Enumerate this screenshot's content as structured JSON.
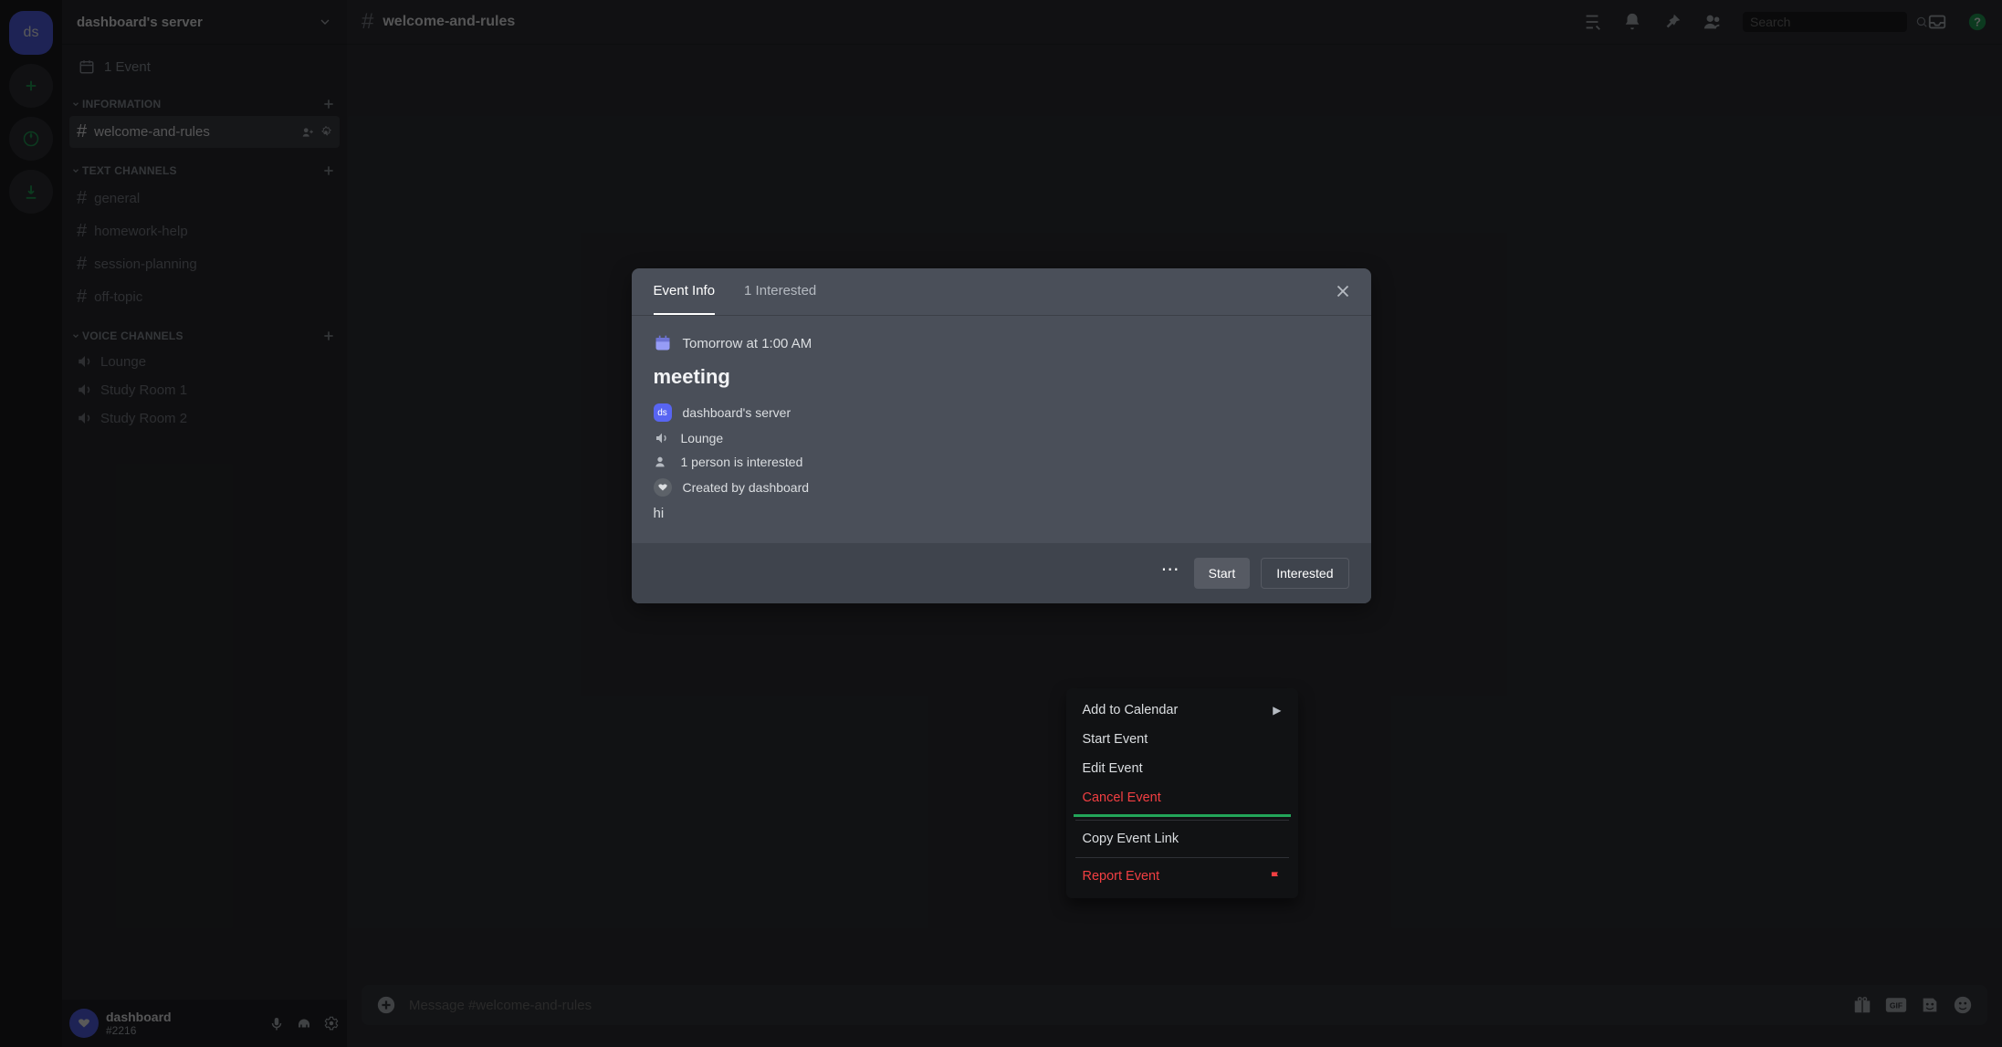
{
  "server": {
    "initials": "ds",
    "name": "dashboard's server"
  },
  "events_label": "1 Event",
  "categories": {
    "information": "INFORMATION",
    "text": "TEXT CHANNELS",
    "voice": "VOICE CHANNELS"
  },
  "channels": {
    "welcome": "welcome-and-rules",
    "general": "general",
    "homework": "homework-help",
    "session": "session-planning",
    "offtopic": "off-topic",
    "lounge": "Lounge",
    "study1": "Study Room 1",
    "study2": "Study Room 2"
  },
  "current_channel": "welcome-and-rules",
  "user": {
    "name": "dashboard",
    "discriminator": "#2216"
  },
  "search_placeholder": "Search",
  "message_placeholder": "Message #welcome-and-rules",
  "modal": {
    "tab_info": "Event Info",
    "tab_interested": "1 Interested",
    "datetime": "Tomorrow at 1:00 AM",
    "title": "meeting",
    "server": "dashboard's server",
    "location": "Lounge",
    "interested": "1 person is interested",
    "created_by": "Created by dashboard",
    "description": "hi",
    "btn_start": "Start",
    "btn_interested": "Interested"
  },
  "menu": {
    "add_calendar": "Add to Calendar",
    "start": "Start Event",
    "edit": "Edit Event",
    "cancel": "Cancel Event",
    "copy_link": "Copy Event Link",
    "report": "Report Event"
  },
  "colors": {
    "blurple": "#5865f2",
    "green": "#23a559",
    "danger": "#f23f42"
  }
}
